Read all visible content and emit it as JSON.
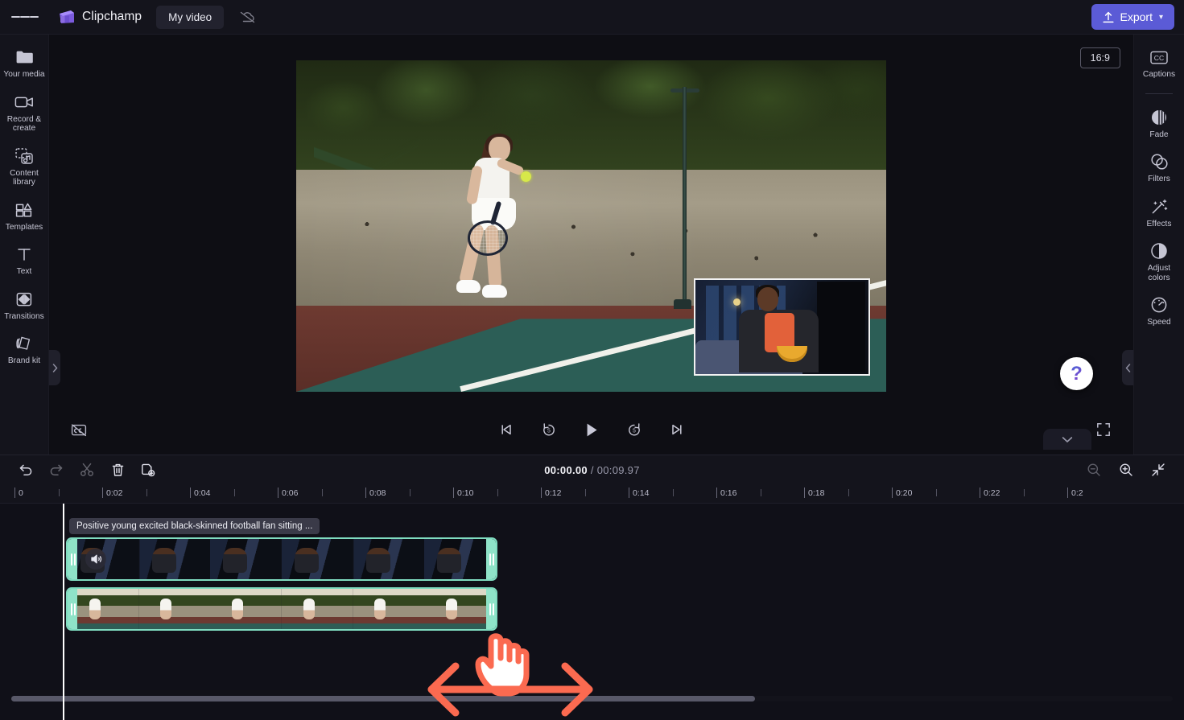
{
  "app": {
    "brand": "Clipchamp",
    "project_name": "My video",
    "menu_icon": "hamburger-icon",
    "cloud_status_icon": "cloud-off-icon",
    "export_label": "Export",
    "export_color": "#5b5bd6"
  },
  "left_rail": {
    "items": [
      {
        "label": "Your media",
        "icon": "folder-icon"
      },
      {
        "label": "Record & create",
        "icon": "video-camera-icon"
      },
      {
        "label": "Content library",
        "icon": "content-library-icon"
      },
      {
        "label": "Templates",
        "icon": "templates-icon"
      },
      {
        "label": "Text",
        "icon": "text-icon"
      },
      {
        "label": "Transitions",
        "icon": "transitions-icon"
      },
      {
        "label": "Brand kit",
        "icon": "brand-kit-icon"
      }
    ]
  },
  "right_rail": {
    "items": [
      {
        "label": "Captions",
        "icon": "closed-caption-icon"
      },
      {
        "label": "Fade",
        "icon": "fade-icon"
      },
      {
        "label": "Filters",
        "icon": "filters-icon"
      },
      {
        "label": "Effects",
        "icon": "effects-wand-icon"
      },
      {
        "label": "Adjust colors",
        "icon": "adjust-colors-icon"
      },
      {
        "label": "Speed",
        "icon": "speedometer-icon"
      }
    ]
  },
  "preview": {
    "aspect_ratio": "16:9",
    "main_scene": "tennis player serving on outdoor court",
    "pip_scene": "man sitting on couch holding bowl of chips",
    "controls": [
      {
        "name": "captions-off",
        "icon": "cc-disabled-icon"
      },
      {
        "name": "skip-to-start",
        "icon": "skip-previous-icon"
      },
      {
        "name": "rewind-5",
        "icon": "replay-5-icon",
        "value": "5"
      },
      {
        "name": "play",
        "icon": "play-icon"
      },
      {
        "name": "forward-5",
        "icon": "forward-5-icon",
        "value": "5"
      },
      {
        "name": "skip-to-end",
        "icon": "skip-next-icon"
      },
      {
        "name": "fullscreen",
        "icon": "fullscreen-icon"
      }
    ],
    "help_label": "?"
  },
  "timeline": {
    "toolbar": [
      {
        "name": "undo",
        "icon": "undo-arrow-icon",
        "enabled": true
      },
      {
        "name": "redo",
        "icon": "redo-arrow-icon",
        "enabled": false
      },
      {
        "name": "split",
        "icon": "scissors-icon",
        "enabled": false
      },
      {
        "name": "delete",
        "icon": "trash-icon",
        "enabled": true
      },
      {
        "name": "duplicate",
        "icon": "duplicate-icon",
        "enabled": true
      }
    ],
    "current_time": "00:00.00",
    "separator": "/",
    "total_time": "00:09.97",
    "zoom_controls": [
      {
        "name": "zoom-out",
        "icon": "zoom-out-icon"
      },
      {
        "name": "zoom-in",
        "icon": "zoom-in-icon"
      },
      {
        "name": "fit-to-screen",
        "icon": "fit-screen-icon"
      }
    ],
    "ruler_labels": [
      "0",
      "0:02",
      "0:04",
      "0:06",
      "0:08",
      "0:10",
      "0:12",
      "0:14",
      "0:16",
      "0:18",
      "0:20",
      "0:22",
      "0:2"
    ],
    "clips": [
      {
        "name": "video-clip-1",
        "label": "Positive young excited black-skinned football fan sitting ...",
        "has_audio_icon": true,
        "thumb_count": 6
      },
      {
        "name": "video-clip-2",
        "label": "",
        "has_audio_icon": false,
        "thumb_count": 6
      }
    ],
    "playhead_time": "0"
  },
  "annotation": {
    "cursor": "pointing-hand-cursor",
    "arrow": "double-headed-horizontal-arrow",
    "color": "#fb6a50"
  }
}
